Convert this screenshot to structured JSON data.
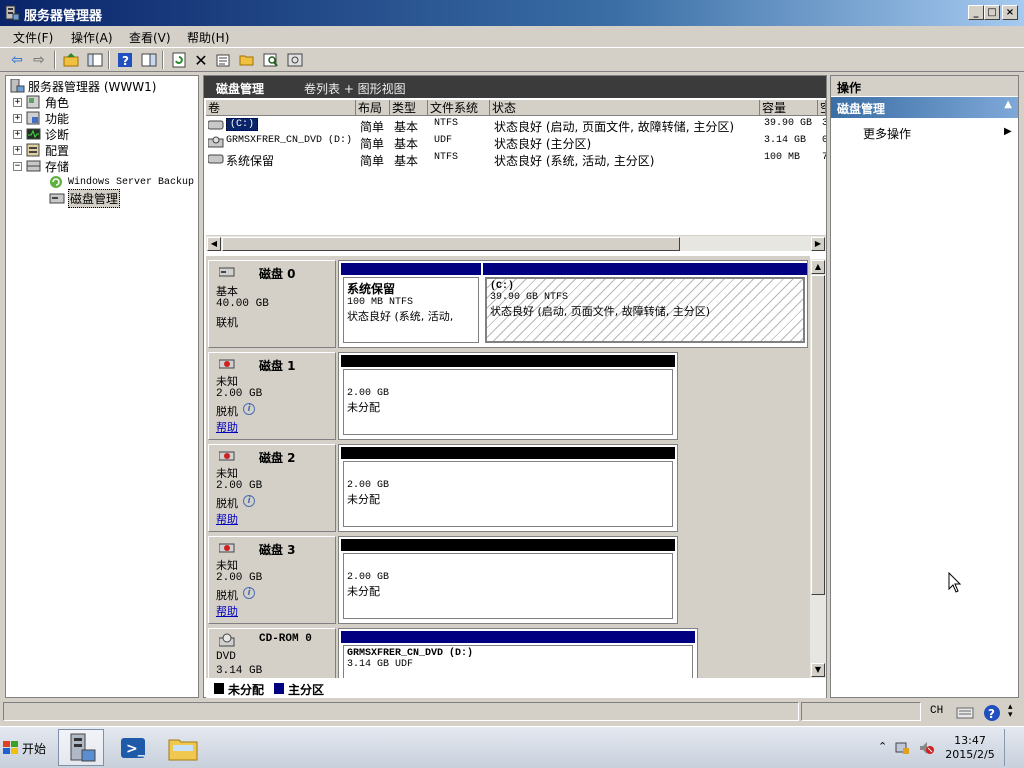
{
  "window": {
    "title": "服务器管理器"
  },
  "menu": [
    "文件(F)",
    "操作(A)",
    "查看(V)",
    "帮助(H)"
  ],
  "tree": {
    "root": "服务器管理器 (WWW1)",
    "items": [
      "角色",
      "功能",
      "诊断",
      "配置",
      "存储"
    ],
    "storage_children": [
      "Windows Server Backup",
      "磁盘管理"
    ]
  },
  "center": {
    "title": "磁盘管理",
    "view": "卷列表 + 图形视图",
    "columns": [
      "卷",
      "布局",
      "类型",
      "文件系统",
      "状态",
      "容量",
      "空"
    ],
    "volumes": [
      {
        "name": "(C:)",
        "layout": "简单",
        "type": "基本",
        "fs": "NTFS",
        "status": "状态良好 (启动, 页面文件, 故障转储, 主分区)",
        "capacity": "39.90 GB",
        "free": "3"
      },
      {
        "name": "GRMSXFRER_CN_DVD (D:)",
        "layout": "简单",
        "type": "基本",
        "fs": "UDF",
        "status": "状态良好 (主分区)",
        "capacity": "3.14 GB",
        "free": "0"
      },
      {
        "name": "系统保留",
        "layout": "简单",
        "type": "基本",
        "fs": "NTFS",
        "status": "状态良好 (系统, 活动, 主分区)",
        "capacity": "100 MB",
        "free": "7"
      }
    ]
  },
  "disks": [
    {
      "name": "磁盘 0",
      "kind": "基本",
      "size": "40.00 GB",
      "state": "联机",
      "partitions": [
        {
          "title": "系统保留",
          "line1": "100 MB NTFS",
          "line2": "状态良好 (系统, 活动,"
        },
        {
          "title": "(C:)",
          "line1": "39.90 GB NTFS",
          "line2": "状态良好 (启动, 页面文件, 故障转储, 主分区)"
        }
      ]
    },
    {
      "name": "磁盘 1",
      "kind": "未知",
      "size": "2.00 GB",
      "state": "脱机",
      "help": "帮助",
      "part_size": "2.00 GB",
      "part_state": "未分配"
    },
    {
      "name": "磁盘 2",
      "kind": "未知",
      "size": "2.00 GB",
      "state": "脱机",
      "help": "帮助",
      "part_size": "2.00 GB",
      "part_state": "未分配"
    },
    {
      "name": "磁盘 3",
      "kind": "未知",
      "size": "2.00 GB",
      "state": "脱机",
      "help": "帮助",
      "part_size": "2.00 GB",
      "part_state": "未分配"
    },
    {
      "name": "CD-ROM 0",
      "kind": "DVD",
      "size": "3.14 GB",
      "part_title": "GRMSXFRER_CN_DVD  (D:)",
      "part_line1": "3.14 GB UDF"
    }
  ],
  "legend": {
    "unallocated": "未分配",
    "primary": "主分区",
    "unallocated_color": "#000000",
    "primary_color": "#000080"
  },
  "actions": {
    "title": "操作",
    "group": "磁盘管理",
    "more": "更多操作"
  },
  "statusbar": {
    "lang": "CH"
  },
  "taskbar": {
    "start": "开始",
    "time": "13:47",
    "date": "2015/2/5"
  }
}
